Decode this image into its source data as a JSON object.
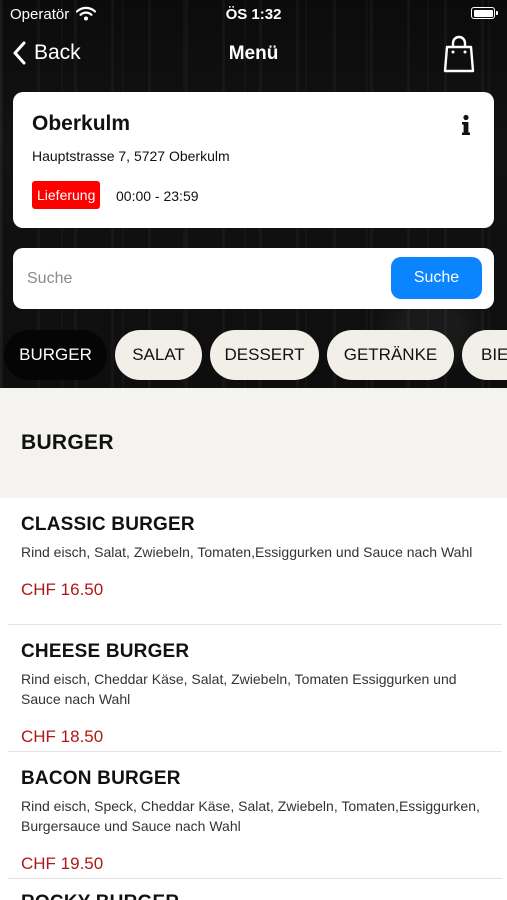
{
  "status": {
    "carrier": "Operatör",
    "time": "ÖS 1:32"
  },
  "nav": {
    "back": "Back",
    "title": "Menü"
  },
  "store": {
    "name": "Oberkulm",
    "address": "Hauptstrasse 7, 5727 Oberkulm",
    "badge": "Lieferung",
    "hours": "00:00 - 23:59"
  },
  "search": {
    "placeholder": "Suche",
    "button": "Suche"
  },
  "categories": [
    "BURGER",
    "SALAT",
    "DESSERT",
    "GETRÄNKE",
    "BIE"
  ],
  "section": {
    "title": "BURGER"
  },
  "items": [
    {
      "name": "CLASSIC BURGER",
      "description": "Rind eisch, Salat, Zwiebeln, Tomaten,Essiggurken und Sauce nach Wahl",
      "price": "CHF 16.50"
    },
    {
      "name": "CHEESE BURGER",
      "description": "Rind eisch, Cheddar Käse, Salat, Zwiebeln, Tomaten Essiggurken und Sauce nach Wahl",
      "price": "CHF 18.50"
    },
    {
      "name": "BACON BURGER",
      "description": "Rind eisch, Speck, Cheddar Käse, Salat, Zwiebeln, Tomaten,Essiggurken, Burgersauce und Sauce nach Wahl",
      "price": "CHF 19.50"
    },
    {
      "name": "ROCKY BURGER",
      "description": "",
      "price": ""
    }
  ],
  "colors": {
    "accent": "#0a84ff",
    "badge": "#ff0000",
    "price": "#b01818"
  }
}
